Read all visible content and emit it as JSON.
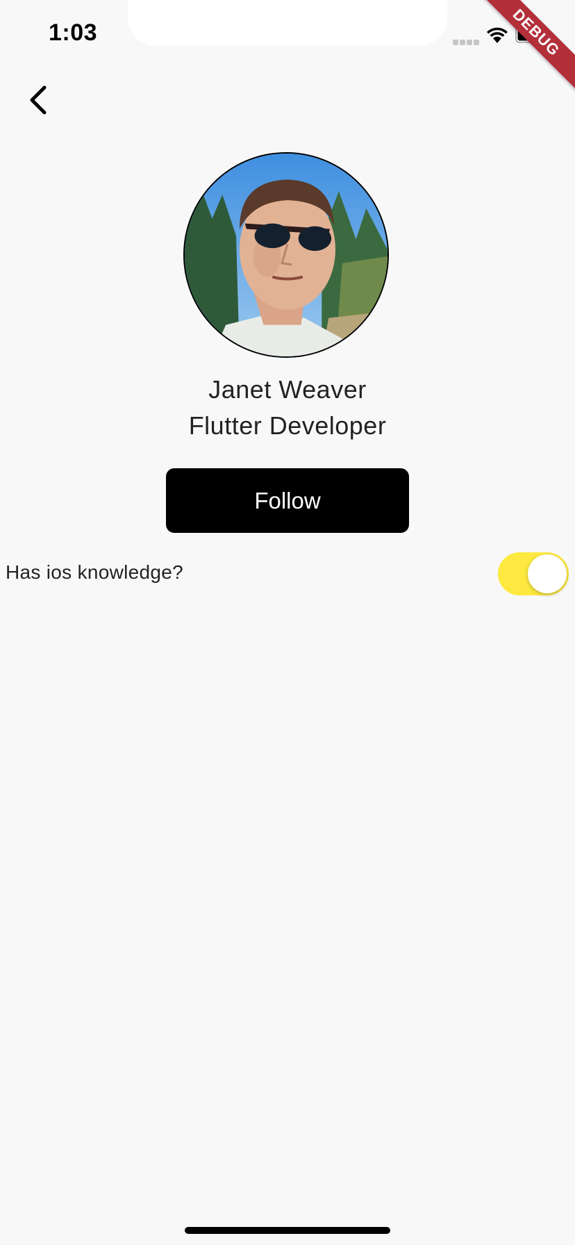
{
  "status_bar": {
    "time": "1:03",
    "debug_label": "DEBUG"
  },
  "nav": {
    "back_icon": "chevron-left-icon"
  },
  "profile": {
    "avatar_icon": "avatar-photo",
    "name": "Janet Weaver",
    "role": "Flutter Developer"
  },
  "actions": {
    "follow_label": "Follow"
  },
  "settings": {
    "ios_knowledge_label": "Has ios knowledge?",
    "ios_knowledge_on": true
  },
  "colors": {
    "background": "#f8f8f8",
    "button": "#000000",
    "toggle_on": "#fde93f",
    "toggle_off": "#e5e5ea",
    "debug_ribbon": "#b32f3a"
  }
}
